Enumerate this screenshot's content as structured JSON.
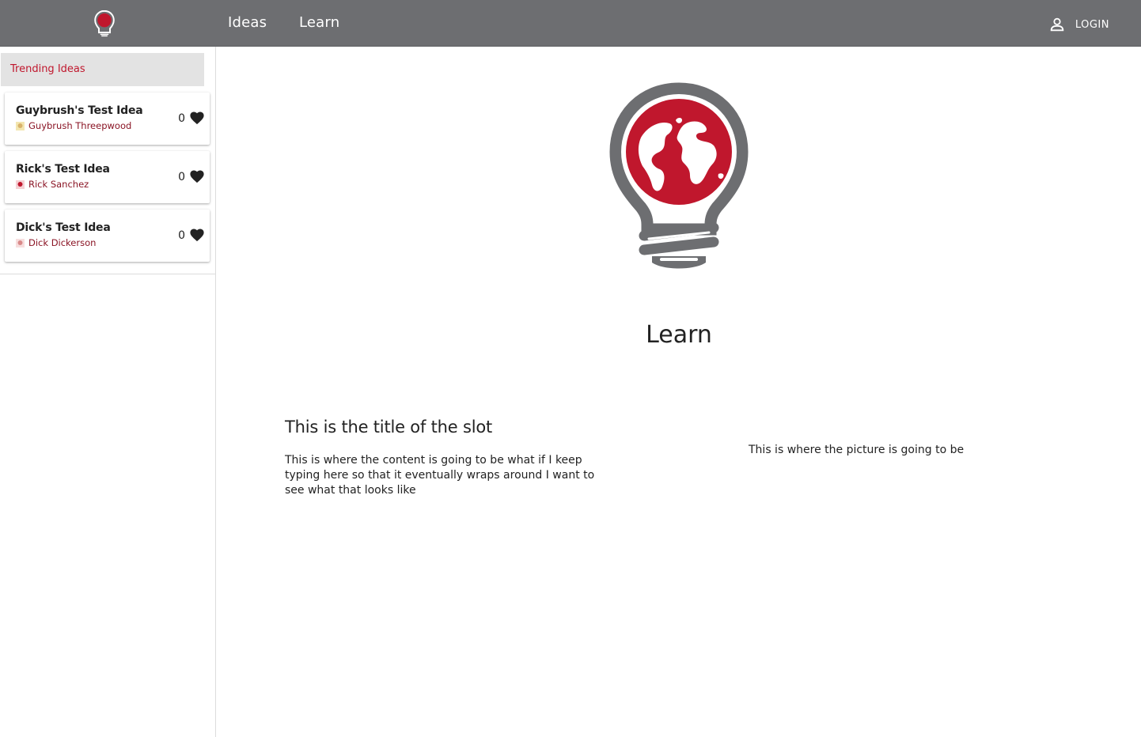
{
  "header": {
    "nav": [
      {
        "label": "Ideas"
      },
      {
        "label": "Learn"
      }
    ],
    "login_label": "LOGIN",
    "background": "#6d6e71"
  },
  "sidebar": {
    "section_label": "Trending Ideas",
    "ideas": [
      {
        "title": "Guybrush's Test Idea",
        "author": "Guybrush Threepwood",
        "likes": "0"
      },
      {
        "title": "Rick's Test Idea",
        "author": "Rick Sanchez",
        "likes": "0"
      },
      {
        "title": "Dick's Test Idea",
        "author": "Dick Dickerson",
        "likes": "0"
      }
    ]
  },
  "main": {
    "heading": "Learn",
    "slot": {
      "title": "This is the title of the slot",
      "content": "This is where the content is going to be what if I keep typing here so that it eventually wraps around I want to see what that looks like",
      "picture_placeholder": "This is where the picture is going to be"
    }
  },
  "colors": {
    "accent_red": "#c0172d",
    "logo_gray": "#6d6e71",
    "author_red": "#8a1424"
  },
  "icons": {
    "logo": "lightbulb-globe-icon",
    "user": "user-icon",
    "like": "heart-icon"
  }
}
